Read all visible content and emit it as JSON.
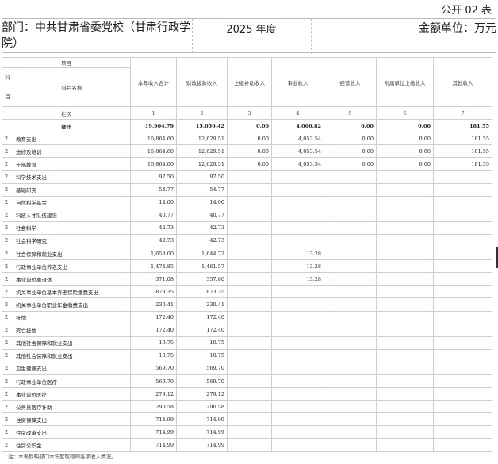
{
  "form_code": "公开 02 表",
  "header": {
    "department": "部门：中共甘肃省委党校（甘肃行政学院）",
    "year": "2025 年度",
    "unit": "金额单位：万元"
  },
  "table": {
    "col_header_item": "项目",
    "col_header_code": "科目",
    "col_header_name": "科目名称",
    "columns": [
      "本年收入合计",
      "财政拨款收入",
      "上级补助收入",
      "事业收入",
      "经营收入",
      "附属单位上缴收入",
      "其他收入"
    ],
    "index_label": "栏次",
    "index_numbers": [
      "1",
      "2",
      "3",
      "4",
      "5",
      "6",
      "7"
    ],
    "total": {
      "name": "合计",
      "values": [
        "19,904.79",
        "15,656.42",
        "0.00",
        "4,066.82",
        "0.00",
        "0.00",
        "181.55"
      ]
    },
    "rows": [
      {
        "code": "2",
        "name": "教育支出",
        "values": [
          "16,864.60",
          "12,629.51",
          "0.00",
          "4,053.54",
          "0.00",
          "0.00",
          "181.55"
        ]
      },
      {
        "code": "2",
        "name": "进修及培训",
        "values": [
          "16,864.60",
          "12,629.51",
          "0.00",
          "4,053.54",
          "0.00",
          "0.00",
          "181.55"
        ]
      },
      {
        "code": "2",
        "name": "干部教育",
        "values": [
          "16,864.60",
          "12,629.51",
          "0.00",
          "4,053.54",
          "0.00",
          "0.00",
          "181.55"
        ]
      },
      {
        "code": "2",
        "name": "科学技术支出",
        "values": [
          "97.50",
          "97.50",
          "",
          "",
          "",
          "",
          ""
        ]
      },
      {
        "code": "2",
        "name": "基础研究",
        "values": [
          "54.77",
          "54.77",
          "",
          "",
          "",
          "",
          ""
        ]
      },
      {
        "code": "2",
        "name": "自然科学基金",
        "values": [
          "14.00",
          "14.00",
          "",
          "",
          "",
          "",
          ""
        ]
      },
      {
        "code": "2",
        "name": "科技人才队伍建设",
        "values": [
          "40.77",
          "40.77",
          "",
          "",
          "",
          "",
          ""
        ]
      },
      {
        "code": "2",
        "name": "社会科学",
        "values": [
          "42.73",
          "42.73",
          "",
          "",
          "",
          "",
          ""
        ]
      },
      {
        "code": "2",
        "name": "社会科学研究",
        "values": [
          "42.73",
          "42.73",
          "",
          "",
          "",
          "",
          ""
        ]
      },
      {
        "code": "2",
        "name": "社会保障和就业支出",
        "values": [
          "1,658.00",
          "1,644.72",
          "",
          "13.28",
          "",
          "",
          ""
        ]
      },
      {
        "code": "2",
        "name": "行政事业单位养老支出",
        "values": [
          "1,474.85",
          "1,461.57",
          "",
          "13.28",
          "",
          "",
          ""
        ]
      },
      {
        "code": "2",
        "name": "事业单位离退休",
        "values": [
          "371.08",
          "357.80",
          "",
          "13.28",
          "",
          "",
          ""
        ]
      },
      {
        "code": "2",
        "name": "机关事业单位基本养老保险缴费支出",
        "values": [
          "873.35",
          "873.35",
          "",
          "",
          "",
          "",
          ""
        ]
      },
      {
        "code": "2",
        "name": "机关事业单位职业年金缴费支出",
        "values": [
          "230.41",
          "230.41",
          "",
          "",
          "",
          "",
          ""
        ]
      },
      {
        "code": "2",
        "name": "抚恤",
        "values": [
          "172.40",
          "172.40",
          "",
          "",
          "",
          "",
          ""
        ]
      },
      {
        "code": "2",
        "name": "死亡抚恤",
        "values": [
          "172.40",
          "172.40",
          "",
          "",
          "",
          "",
          ""
        ]
      },
      {
        "code": "2",
        "name": "其他社会保障和就业支出",
        "values": [
          "10.75",
          "10.75",
          "",
          "",
          "",
          "",
          ""
        ]
      },
      {
        "code": "2",
        "name": "其他社会保障和就业支出",
        "values": [
          "10.75",
          "10.75",
          "",
          "",
          "",
          "",
          ""
        ]
      },
      {
        "code": "2",
        "name": "卫生健康支出",
        "values": [
          "569.70",
          "569.70",
          "",
          "",
          "",
          "",
          ""
        ]
      },
      {
        "code": "2",
        "name": "行政事业单位医疗",
        "values": [
          "569.70",
          "569.70",
          "",
          "",
          "",
          "",
          ""
        ]
      },
      {
        "code": "2",
        "name": "事业单位医疗",
        "values": [
          "279.12",
          "279.12",
          "",
          "",
          "",
          "",
          ""
        ]
      },
      {
        "code": "2",
        "name": "公务员医疗补助",
        "values": [
          "290.58",
          "290.58",
          "",
          "",
          "",
          "",
          ""
        ]
      },
      {
        "code": "2",
        "name": "住房保障支出",
        "values": [
          "714.99",
          "714.99",
          "",
          "",
          "",
          "",
          ""
        ]
      },
      {
        "code": "2",
        "name": "住房改革支出",
        "values": [
          "714.99",
          "714.99",
          "",
          "",
          "",
          "",
          ""
        ]
      },
      {
        "code": "2",
        "name": "住房公积金",
        "values": [
          "714.99",
          "714.99",
          "",
          "",
          "",
          "",
          ""
        ]
      }
    ]
  },
  "note": "注：本表反映部门本年度取得的各项收入情况。"
}
